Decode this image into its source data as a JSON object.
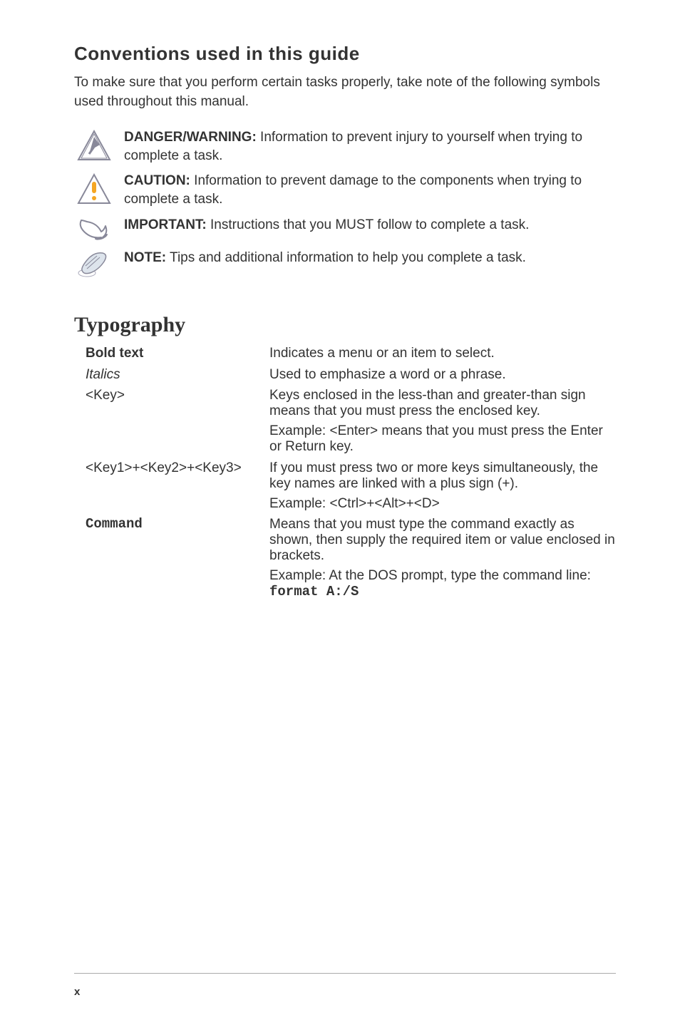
{
  "section_heading": "Conventions used in this guide",
  "intro": "To make sure that you perform certain tasks properly, take note of the following symbols used throughout this manual.",
  "alerts": {
    "danger": {
      "lead": "DANGER/WARNING:",
      "text": " Information to prevent injury to yourself when trying to complete a task."
    },
    "caution": {
      "lead": "CAUTION:",
      "text": " Information to prevent damage to the components when trying to complete a task."
    },
    "important": {
      "lead": "IMPORTANT:",
      "text": " Instructions that you MUST follow to complete a task."
    },
    "note": {
      "lead": "NOTE:",
      "text": " Tips and additional information to help you complete a task."
    }
  },
  "typography_heading": "Typography",
  "typo": {
    "bold": {
      "term": "Bold text",
      "def": "Indicates a menu or an item to select."
    },
    "italics": {
      "term": "Italics",
      "def": "Used to emphasize a word or a phrase."
    },
    "key": {
      "term": "<Key>",
      "def1": "Keys enclosed in the less-than and greater-than sign means that you must press the enclosed key.",
      "def2": "Example: <Enter> means that you must press the Enter or Return key."
    },
    "keys3": {
      "term": "<Key1>+<Key2>+<Key3>",
      "def1": "If you must press two or more keys simultaneously, the key names are linked with a plus sign (+).",
      "def2": "Example: <Ctrl>+<Alt>+<D>"
    },
    "command": {
      "term": "Command",
      "def1": "Means that you must type the command exactly as shown, then supply the required item or value enclosed in brackets.",
      "def2a": "Example: At the DOS prompt, type the command line: ",
      "def2b": "format A:/S"
    }
  },
  "page_number": "x"
}
